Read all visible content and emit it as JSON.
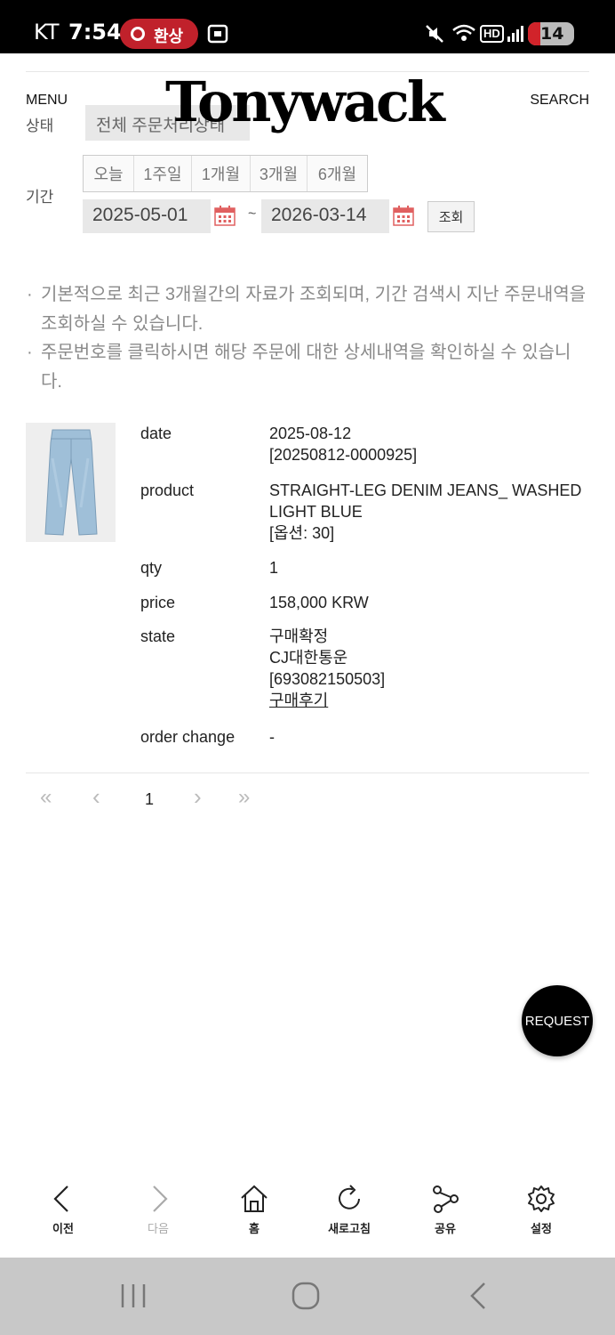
{
  "status_bar": {
    "carrier": "KT",
    "time": "7:54",
    "pill_label": "환상",
    "network_label": "HD",
    "battery_level": "14"
  },
  "header": {
    "menu_label": "MENU",
    "logo": "Tonywack",
    "search_label": "SEARCH"
  },
  "filter": {
    "status_label": "상태",
    "status_select_value": "전체 주문처리상태",
    "period_label": "기간",
    "period_buttons": [
      "오늘",
      "1주일",
      "1개월",
      "3개월",
      "6개월"
    ],
    "date_from": "2025-05-01",
    "date_separator": "~",
    "date_to": "2026-03-14",
    "search_button": "조회"
  },
  "notices": [
    "기본적으로 최근 3개월간의 자료가 조회되며, 기간 검색시 지난 주문내역을 조회하실 수 있습니다.",
    "주문번호를 클릭하시면 해당 주문에 대한 상세내역을 확인하실 수 있습니다."
  ],
  "order": {
    "date_label": "date",
    "date_value": "2025-08-12",
    "order_number": "[20250812-0000925]",
    "product_label": "product",
    "product_name": "STRAIGHT-LEG DENIM JEANS_ WASHED LIGHT BLUE",
    "product_option": "[옵션: 30]",
    "qty_label": "qty",
    "qty_value": "1",
    "price_label": "price",
    "price_value": "158,000 KRW",
    "state_label": "state",
    "state_value": "구매확정",
    "carrier": "CJ대한통운",
    "tracking_number": "[693082150503]",
    "review_link": "구매후기",
    "order_change_label": "order change",
    "order_change_value": "-"
  },
  "pagination": {
    "first": "«",
    "prev": "‹",
    "current_page": "1",
    "next": "›",
    "last": "»"
  },
  "fab": {
    "label": "REQUEST"
  },
  "browser_toolbar": {
    "back": "이전",
    "forward": "다음",
    "home": "홈",
    "refresh": "새로고침",
    "share": "공유",
    "settings": "설정"
  }
}
